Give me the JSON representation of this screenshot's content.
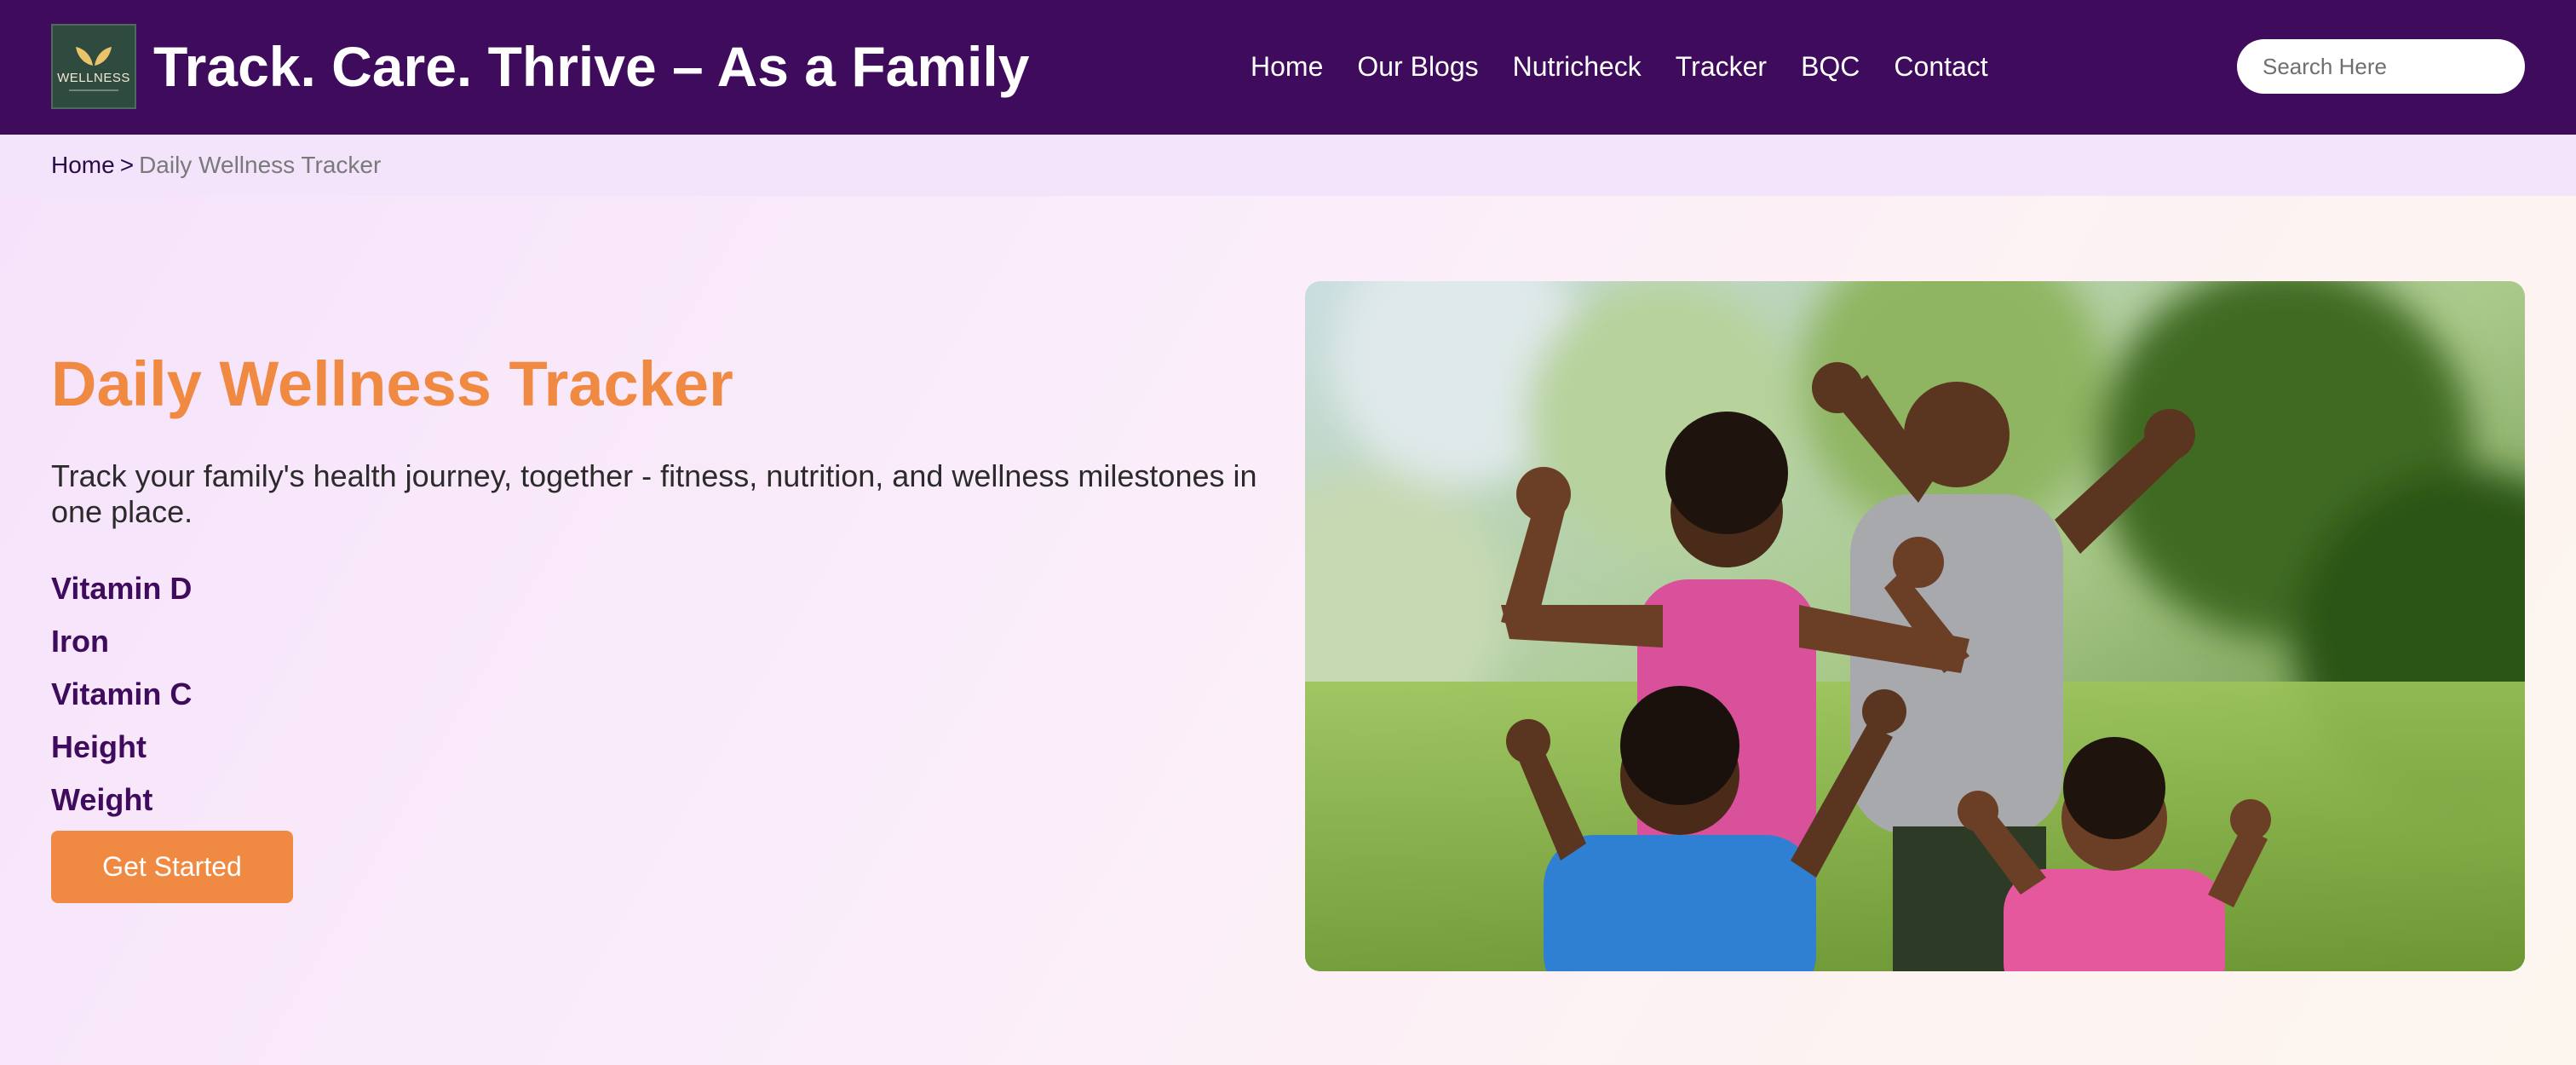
{
  "header": {
    "logo_text": "WELLNESS",
    "site_title": "Track. Care. Thrive – As a Family",
    "nav": [
      {
        "label": "Home"
      },
      {
        "label": "Our Blogs"
      },
      {
        "label": "Nutricheck"
      },
      {
        "label": "Tracker"
      },
      {
        "label": "BQC"
      },
      {
        "label": "Contact"
      }
    ],
    "search": {
      "placeholder": "Search Here",
      "value": ""
    }
  },
  "breadcrumb": {
    "home": "Home",
    "separator": ">",
    "current": "Daily Wellness Tracker"
  },
  "hero": {
    "title": "Daily Wellness Tracker",
    "description": "Track your family's health journey, together - fitness, nutrition, and wellness milestones in one place.",
    "metrics": [
      "Vitamin D",
      "Iron",
      "Vitamin C",
      "Height",
      "Weight"
    ],
    "cta_label": "Get Started"
  },
  "colors": {
    "header_bg": "#3f0b5c",
    "accent_orange": "#f08a42",
    "metric_text": "#3f0b5c",
    "breadcrumb_bg": "#f3e4fb"
  }
}
